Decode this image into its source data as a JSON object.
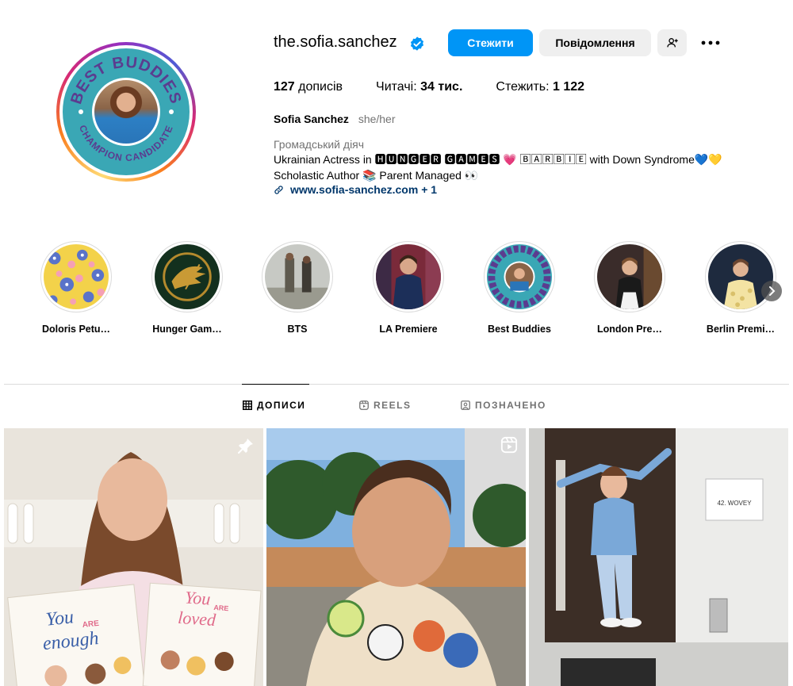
{
  "profile": {
    "username": "the.sofia.sanchez",
    "verified": true,
    "follow_label": "Стежити",
    "message_label": "Повідомлення",
    "avatar_badge_top": "BEST BUDDIES",
    "avatar_badge_bottom": "CHAMPION CANDIDATE",
    "stats": {
      "posts_value": "127",
      "posts_label": "дописів",
      "followers_label": "Читачі:",
      "followers_value": "34 тис.",
      "following_label": "Стежить:",
      "following_value": "1 122"
    },
    "full_name": "Sofia Sanchez",
    "pronouns": "she/her",
    "category": "Громадський діяч",
    "bio_line1": "Ukrainian Actress in 🅷🆄🅽🅶🅴🆁 🅶🅰🅼🅴🆂 💗 🄱🄰🅁🄱🄸🄴 with Down Syndrome💙💛",
    "bio_line2": "Scholastic Author 📚 Parent Managed 👀",
    "link": "www.sofia-sanchez.com + 1"
  },
  "highlights": [
    {
      "label": "Doloris Petu…",
      "thumb": "floral-pattern"
    },
    {
      "label": "Hunger Gam…",
      "thumb": "mockingjay-pin"
    },
    {
      "label": "BTS",
      "thumb": "set-photo"
    },
    {
      "label": "LA Premiere",
      "thumb": "premiere-photo"
    },
    {
      "label": "Best Buddies",
      "thumb": "best-buddies-badge"
    },
    {
      "label": "London Pre…",
      "thumb": "london-premiere-photo"
    },
    {
      "label": "Berlin Premi…",
      "thumb": "berlin-premiere-photo"
    }
  ],
  "tabs": [
    {
      "label": "ДОПИСИ",
      "icon": "grid-icon",
      "active": true
    },
    {
      "label": "REELS",
      "icon": "reels-icon",
      "active": false
    },
    {
      "label": "ПОЗНАЧЕНО",
      "icon": "tagged-icon",
      "active": false
    }
  ],
  "posts": [
    {
      "kind": "photo",
      "pinned": true,
      "book1_title_a": "You",
      "book1_title_b": "ARE",
      "book1_title_c": "enough",
      "book2_title_a": "You",
      "book2_title_b": "ARE",
      "book2_title_c": "loved"
    },
    {
      "kind": "video",
      "pinned": false
    },
    {
      "kind": "photo",
      "pinned": false,
      "sign_text": "42. WOVEY"
    }
  ],
  "colors": {
    "accent": "#0095f6",
    "link": "#00376b",
    "secondary_text": "#737373",
    "button_gray": "#efefef",
    "badge_teal": "#3aa7b5",
    "badge_purple": "#5b3c8f"
  }
}
